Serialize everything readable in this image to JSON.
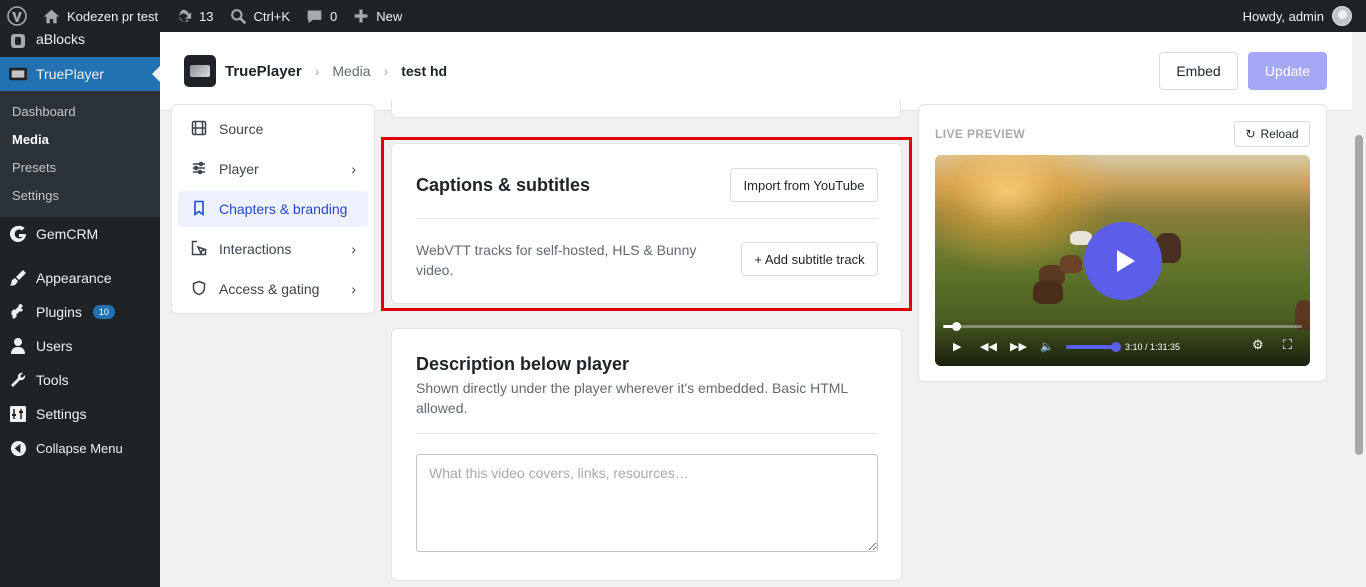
{
  "adminbar": {
    "site_name": "Kodezen pr test",
    "updates_count": "13",
    "search_shortcut": "Ctrl+K",
    "comments_count": "0",
    "new_label": "New",
    "howdy": "Howdy, admin"
  },
  "sidebar": {
    "items": [
      {
        "label": "aBlocks",
        "icon": "ablocks-icon"
      },
      {
        "label": "TruePlayer",
        "icon": "trueplayer-icon"
      },
      {
        "label": "GemCRM",
        "icon": "gemcrm-icon"
      },
      {
        "label": "Appearance",
        "icon": "appearance-icon"
      },
      {
        "label": "Plugins",
        "icon": "plugins-icon",
        "badge": "10"
      },
      {
        "label": "Users",
        "icon": "users-icon"
      },
      {
        "label": "Tools",
        "icon": "tools-icon"
      },
      {
        "label": "Settings",
        "icon": "settings-icon"
      },
      {
        "label": "Collapse Menu",
        "icon": "collapse-icon"
      }
    ],
    "submenu": [
      "Dashboard",
      "Media",
      "Presets",
      "Settings"
    ],
    "current_submenu": "Media"
  },
  "header": {
    "brand": "TruePlayer",
    "breadcrumb_section": "Media",
    "breadcrumb_current": "test hd",
    "embed_label": "Embed",
    "update_label": "Update"
  },
  "nav": {
    "items": [
      {
        "label": "Source",
        "icon": "film-icon",
        "has_children": false
      },
      {
        "label": "Player",
        "icon": "sliders-icon",
        "has_children": true
      },
      {
        "label": "Chapters & branding",
        "icon": "bookmark-icon",
        "has_children": false,
        "active": true
      },
      {
        "label": "Interactions",
        "icon": "cursor-icon",
        "has_children": true
      },
      {
        "label": "Access & gating",
        "icon": "shield-icon",
        "has_children": true
      }
    ]
  },
  "captions": {
    "title": "Captions & subtitles",
    "import_label": "Import from YouTube",
    "description": "WebVTT tracks for self-hosted, HLS & Bunny video.",
    "add_track_label": "+ Add subtitle track"
  },
  "description_card": {
    "title": "Description below player",
    "subtitle": "Shown directly under the player wherever it's embedded. Basic HTML allowed.",
    "placeholder": "What this video covers, links, resources…",
    "value": ""
  },
  "preview": {
    "label": "LIVE PREVIEW",
    "reload_label": "Reload",
    "timecode": "3:10 / 1:31:35",
    "progress_fraction": 0.035,
    "volume_fraction": 1.0
  },
  "colors": {
    "wp_admin_dark": "#1d2327",
    "wp_blue": "#2271b1",
    "accent": "#5b5ee8",
    "highlight": "#e00000",
    "update_button": "#a5a8f7"
  }
}
